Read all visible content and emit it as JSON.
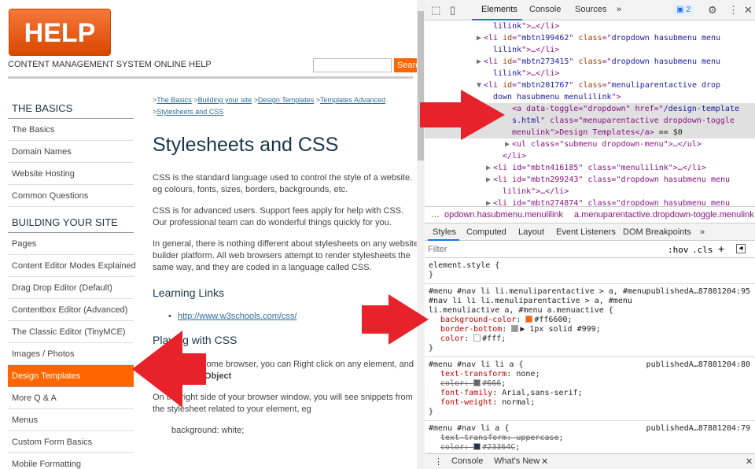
{
  "site": {
    "logo": "HELP",
    "tagline": "CONTENT MANAGEMENT SYSTEM ONLINE HELP",
    "search_button": "Search"
  },
  "sidebar": {
    "sections": [
      {
        "heading": "THE BASICS",
        "items": [
          "The Basics",
          "Domain Names",
          "Website Hosting",
          "Common Questions"
        ]
      },
      {
        "heading": "BUILDING YOUR SITE",
        "items": [
          "Pages",
          "Content Editor Modes Explained",
          "Drag Drop Editor (Default)",
          "Contentbox Editor (Advanced)",
          "The Classic Editor (TinyMCE)",
          "Images / Photos",
          "Design Templates",
          "More Q & A",
          "Menus",
          "Custom Form Basics",
          "Mobile Formatting"
        ]
      }
    ],
    "active": "Design Templates"
  },
  "content": {
    "breadcrumb": [
      ">",
      "The Basics",
      " >",
      "Building your site",
      " >",
      "Design Templates",
      " >",
      "Templates Advanced",
      ">",
      "Stylesheets and CSS"
    ],
    "title": "Stylesheets and CSS",
    "p1": "CSS is the standard language used to control the style of a website. eg colours, fonts, sizes, borders, backgrounds, etc.",
    "p2": "CSS is for advanced users. Support fees apply for help with CSS. Our professional team can do wonderful things quickly for you.",
    "p3": "In general, there is nothing different about stylesheets on any website builder platform. All web browsers attempt to render stylesheets the same way, and they are coded in a language called CSS.",
    "h_links": "Learning Links",
    "link": "http://www.w3schools.com/css/",
    "h_play": "Playing with CSS",
    "p4a": "If you use Chrome browser, you can Right click on any element, and click ",
    "p4b": "Inspect Object",
    "p5": "On the right side of your browser window, you will see snippets from the stylesheet related to your element, eg",
    "code": "background: white;"
  },
  "devtools": {
    "tabs": [
      "Elements",
      "Console",
      "Sources",
      "»"
    ],
    "badge": "2",
    "elements": [
      {
        "ind": 6,
        "tri": "",
        "html": "lilink\">…</li>"
      },
      {
        "ind": 5,
        "tri": "▶",
        "id": "mbtn199462",
        "cls": "dropdown hasubmenu menu"
      },
      {
        "ind": 6,
        "tri": "",
        "html": "lilink\">…</li>"
      },
      {
        "ind": 5,
        "tri": "▶",
        "id": "mbtn273415",
        "cls": "dropdown hasubmenu menu"
      },
      {
        "ind": 6,
        "tri": "",
        "html": "lilink\">…</li>"
      },
      {
        "ind": 5,
        "tri": "▼",
        "id": "mbtn201767",
        "cls": "menuliparentactive drop"
      },
      {
        "ind": 6,
        "tri": "",
        "html": "down hasubmenu menulilink\">"
      }
    ],
    "selected_line1a": "<a data-toggle=\"dropdown\" href=\"",
    "selected_href": "/design-template",
    "selected_line2a": "s.html",
    "selected_line2b": "\" class=\"menuparentactive dropdown-toggle",
    "selected_line3": "menulink\">Design Templates</a>",
    "selected_eq": " == $0",
    "after": [
      {
        "tri": "▶",
        "html": "<ul class=\"submenu dropdown-menu\">…</ul>",
        "ind": 2
      },
      {
        "tri": "",
        "html": "</li>",
        "ind": 1
      },
      {
        "tri": "▶",
        "html": "<li id=\"mbtn416185\" class=\"menulilink\">…</li>",
        "ind": 0
      },
      {
        "tri": "▶",
        "html": "<li id=\"mbtn299243\" class=\"dropdown hasubmenu menu",
        "ind": 0
      },
      {
        "tri": "",
        "html": "lilink\">…</li>",
        "ind": 1
      },
      {
        "tri": "▶",
        "html": "<li id=\"mbtn274874\" class=\"dropdown hasubmenu menu",
        "ind": 0
      }
    ],
    "crumb1": "opdown.hasubmenu.menulilink",
    "crumb2": "a.menuparentactive.dropdown-toggle.menulink",
    "style_tabs": [
      "Styles",
      "Computed",
      "Layout",
      "Event Listeners",
      "DOM Breakpoints",
      "»"
    ],
    "filter_placeholder": "Filter",
    "hov": ":hov",
    "cls": ".cls",
    "element_style": "element.style {",
    "rule1_sel": [
      "#menu #nav li li.menuliparentactive > a, #menu",
      "#nav li li li.menuliparentactive > a, #menu",
      "li.menuliactive a, #menu a.menuactive {"
    ],
    "rule1_src": "publishedA…87881204:95",
    "rule1_props": [
      {
        "n": "background-color",
        "v": "#ff6600",
        "sw": "#ff6600"
      },
      {
        "n": "border-bottom",
        "v": "▶ 1px solid #999",
        "sw": "#999999"
      },
      {
        "n": "color",
        "v": "#fff",
        "sw": "#ffffff"
      }
    ],
    "rule2_sel": "#menu #nav li li a {",
    "rule2_src": "publishedA…87881204:80",
    "rule2_props": [
      {
        "n": "text-transform",
        "v": "none",
        "s": false
      },
      {
        "n": "color",
        "v": "#666",
        "s": true,
        "sw": "#666666"
      },
      {
        "n": "font-family",
        "v": "Arial,sans-serif",
        "s": false
      },
      {
        "n": "font-weight",
        "v": "normal",
        "s": false
      }
    ],
    "rule3_sel": "#menu #nav li a {",
    "rule3_src": "publishedA…87881204:79",
    "rule3_props": [
      {
        "n": "text-transform",
        "v": "uppercase",
        "s": true
      },
      {
        "n": "color",
        "v": "#23364C",
        "s": true,
        "sw": "#23364c"
      }
    ],
    "drawer": [
      "Console",
      "What's New"
    ],
    "close_brace": "}"
  },
  "colors": {
    "accent": "#ff6600",
    "arrow": "#e8222a",
    "heading": "#17364c"
  }
}
